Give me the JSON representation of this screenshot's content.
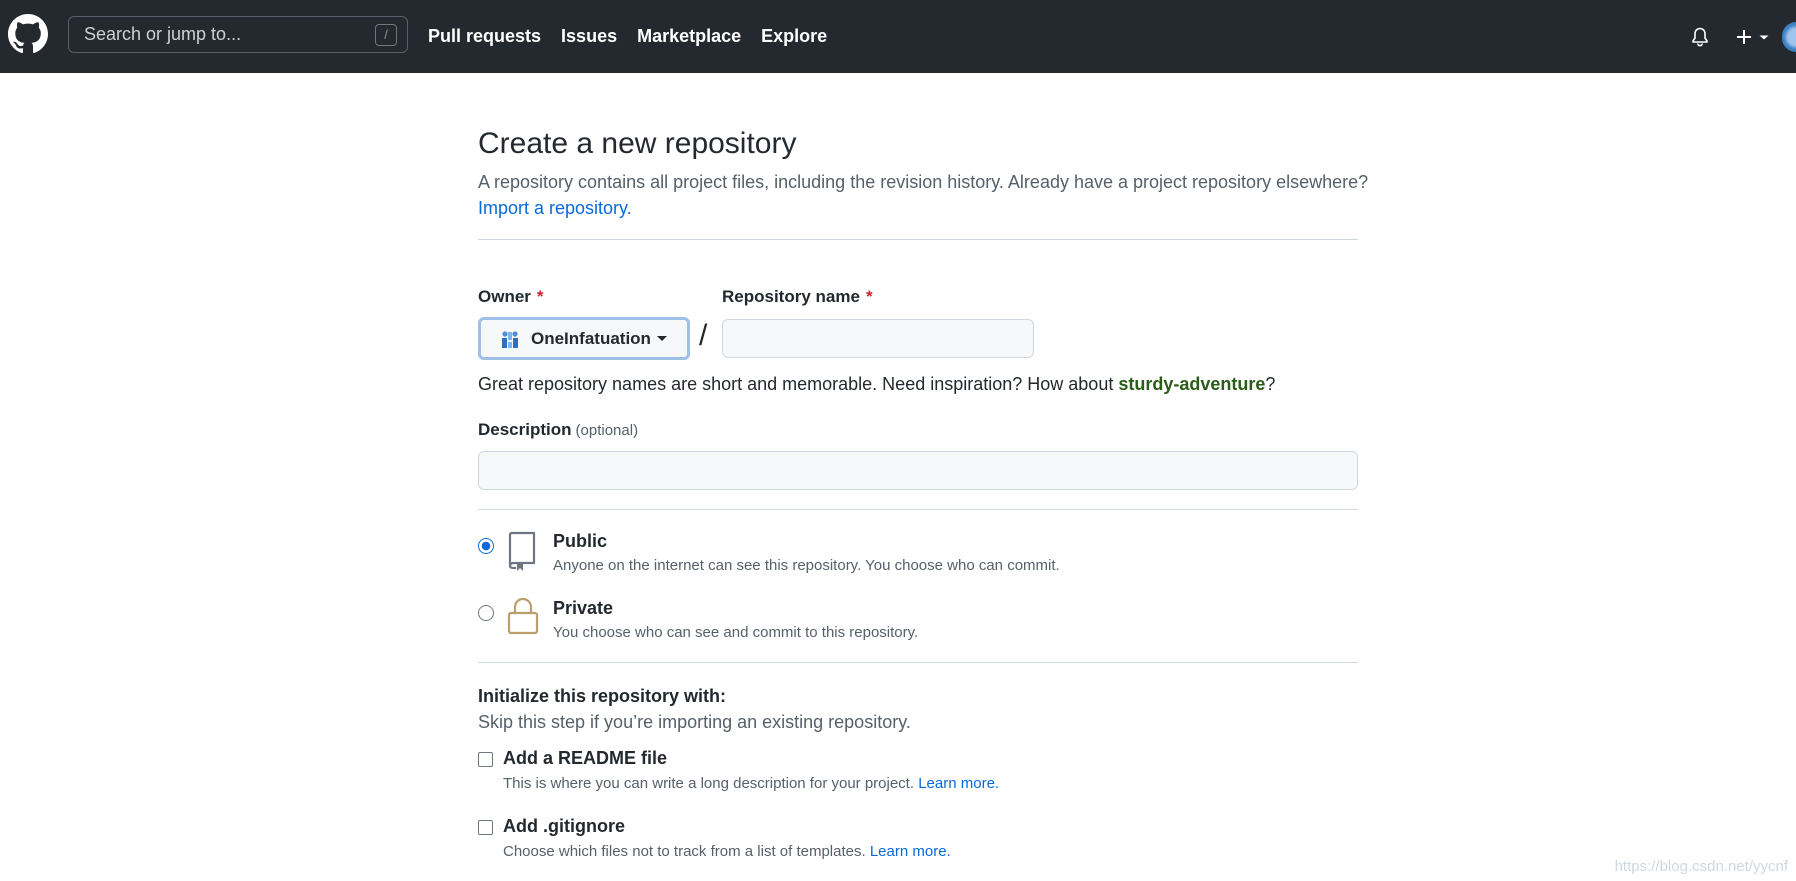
{
  "header": {
    "search_placeholder": "Search or jump to...",
    "search_shortcut": "/",
    "nav": [
      "Pull requests",
      "Issues",
      "Marketplace",
      "Explore"
    ]
  },
  "page": {
    "title": "Create a new repository",
    "subtitle": "A repository contains all project files, including the revision history. Already have a project repository elsewhere?",
    "import_link": "Import a repository."
  },
  "form": {
    "owner_label": "Owner",
    "required_mark": "*",
    "owner_value": "OneInfatuation",
    "separator": "/",
    "repo_label": "Repository name",
    "repo_value": "",
    "hint_prefix": "Great repository names are short and memorable. Need inspiration? How about ",
    "hint_suggestion": "sturdy-adventure",
    "hint_suffix": "?",
    "description_label": "Description",
    "description_optional": "(optional)",
    "description_value": ""
  },
  "visibility": {
    "public": {
      "title": "Public",
      "desc": "Anyone on the internet can see this repository. You choose who can commit.",
      "checked": true
    },
    "private": {
      "title": "Private",
      "desc": "You choose who can see and commit to this repository.",
      "checked": false
    }
  },
  "init": {
    "title": "Initialize this repository with:",
    "subtitle": "Skip this step if you’re importing an existing repository.",
    "readme": {
      "title": "Add a README file",
      "desc": "This is where you can write a long description for your project.",
      "link": "Learn more."
    },
    "gitignore": {
      "title": "Add .gitignore",
      "desc": "Choose which files not to track from a list of templates.",
      "link": "Learn more."
    }
  },
  "watermark": "https://blog.csdn.net/yycnf",
  "colors": {
    "header_bg": "#24292f",
    "link": "#0969da",
    "required": "#cf222e",
    "suggestion": "#2a5d18"
  }
}
